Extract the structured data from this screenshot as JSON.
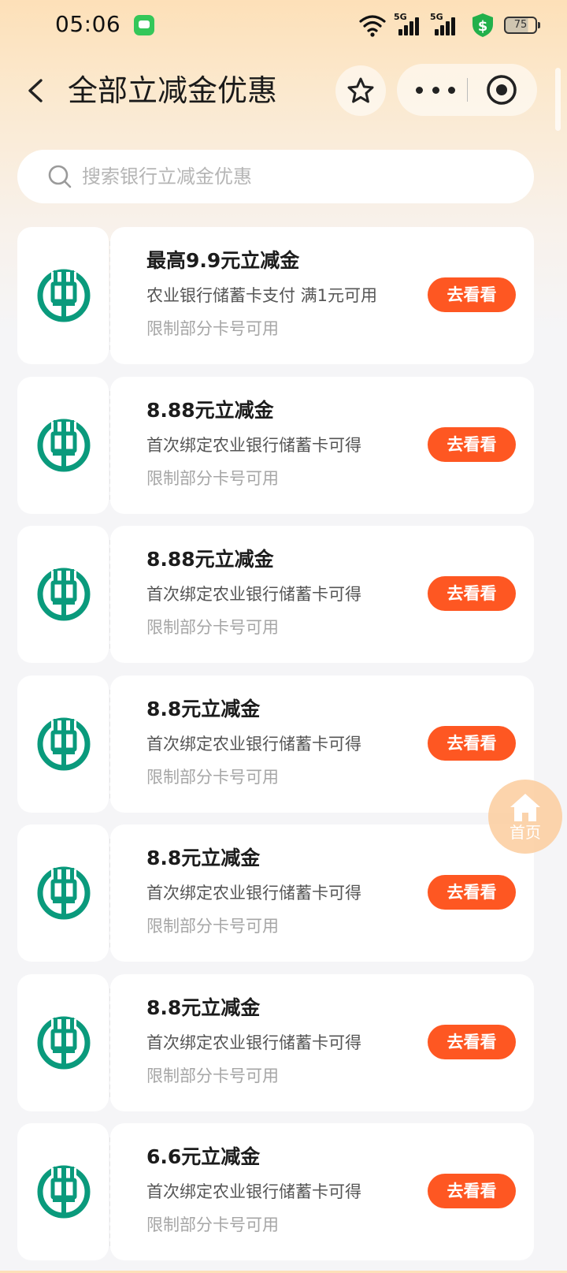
{
  "status_bar": {
    "time": "05:06",
    "signal1_label": "5G",
    "signal2_label": "5G",
    "battery": "75",
    "message_icon": "message-icon",
    "wifi_icon": "wifi-icon",
    "shield_icon": "shield-dollar-icon"
  },
  "header": {
    "title": "全部立减金优惠",
    "back_icon": "chevron-left-icon",
    "favorite_icon": "star-icon",
    "more_icon": "more-dots-icon",
    "close_icon": "target-close-icon"
  },
  "search": {
    "placeholder": "搜索银行立减金优惠",
    "value": ""
  },
  "colors": {
    "accent": "#fe5722",
    "bank_green": "#0a9a7c",
    "home_float": "#fccd9e"
  },
  "coupons": [
    {
      "title": "最高9.9元立减金",
      "desc": "农业银行储蓄卡支付 满1元可用",
      "limit": "限制部分卡号可用",
      "button": "去看看",
      "logo": "abc-bank-logo"
    },
    {
      "title": "8.88元立减金",
      "desc": "首次绑定农业银行储蓄卡可得",
      "limit": "限制部分卡号可用",
      "button": "去看看",
      "logo": "abc-bank-logo"
    },
    {
      "title": "8.88元立减金",
      "desc": "首次绑定农业银行储蓄卡可得",
      "limit": "限制部分卡号可用",
      "button": "去看看",
      "logo": "abc-bank-logo"
    },
    {
      "title": "8.8元立减金",
      "desc": "首次绑定农业银行储蓄卡可得",
      "limit": "限制部分卡号可用",
      "button": "去看看",
      "logo": "abc-bank-logo"
    },
    {
      "title": "8.8元立减金",
      "desc": "首次绑定农业银行储蓄卡可得",
      "limit": "限制部分卡号可用",
      "button": "去看看",
      "logo": "abc-bank-logo"
    },
    {
      "title": "8.8元立减金",
      "desc": "首次绑定农业银行储蓄卡可得",
      "limit": "限制部分卡号可用",
      "button": "去看看",
      "logo": "abc-bank-logo"
    },
    {
      "title": "6.6元立减金",
      "desc": "首次绑定农业银行储蓄卡可得",
      "limit": "限制部分卡号可用",
      "button": "去看看",
      "logo": "abc-bank-logo"
    }
  ],
  "home_float": {
    "label": "首页",
    "icon": "home-icon"
  }
}
